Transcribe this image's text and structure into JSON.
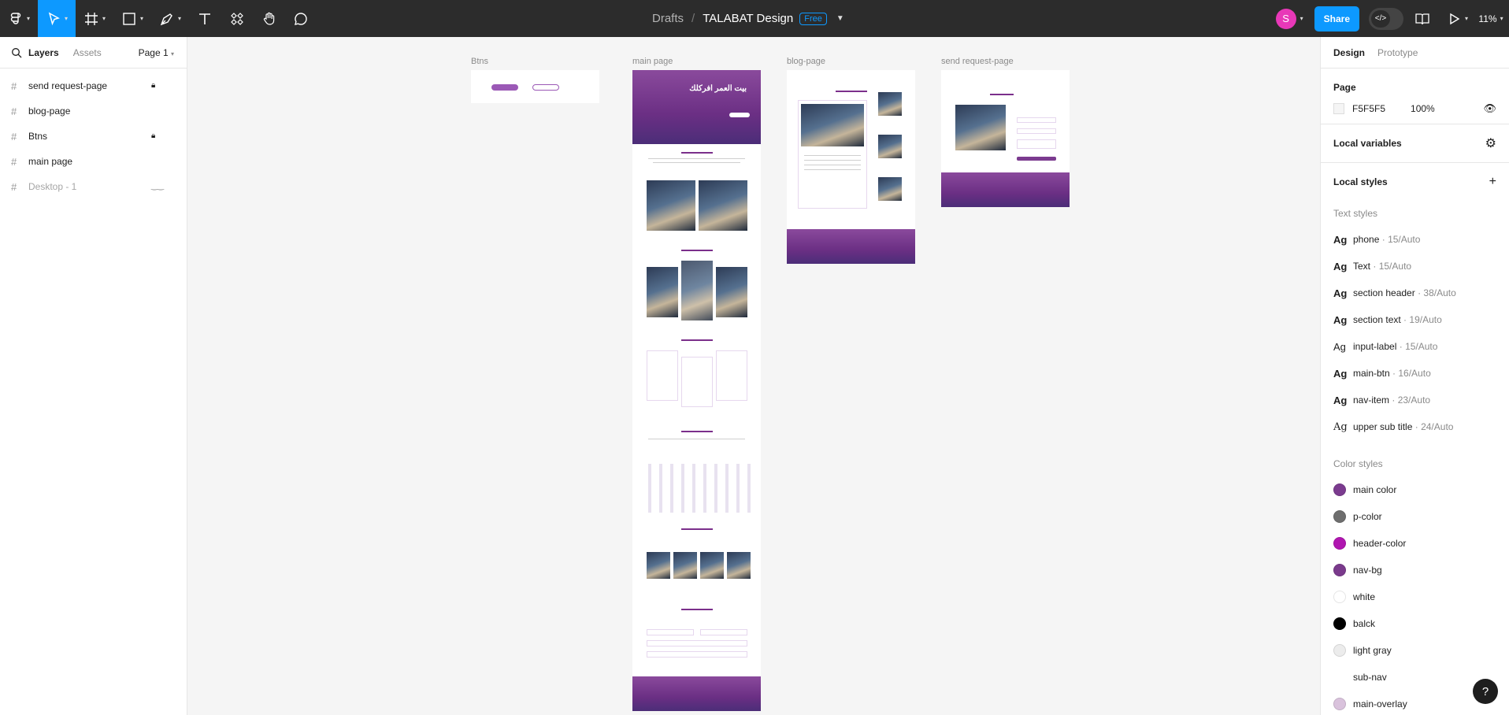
{
  "toolbar": {
    "breadcrumb": "Drafts",
    "separator": "/",
    "file_name": "TALABAT Design",
    "plan_badge": "Free",
    "avatar_initial": "S",
    "share_label": "Share",
    "zoom": "11%"
  },
  "left_panel": {
    "tabs": {
      "layers": "Layers",
      "assets": "Assets"
    },
    "page_selector": "Page 1",
    "layers": [
      {
        "name": "send request-page",
        "locked": true,
        "hidden": false
      },
      {
        "name": "blog-page",
        "locked": false,
        "hidden": false
      },
      {
        "name": "Btns",
        "locked": true,
        "hidden": false
      },
      {
        "name": "main page",
        "locked": false,
        "hidden": false
      },
      {
        "name": "Desktop - 1",
        "locked": false,
        "hidden": true
      }
    ]
  },
  "canvas": {
    "frames": {
      "btns": "Btns",
      "main": "main page",
      "blog": "blog-page",
      "send": "send request-page"
    },
    "hero_heading": "بيت العمر افركلك"
  },
  "right_panel": {
    "tabs": {
      "design": "Design",
      "prototype": "Prototype"
    },
    "page": {
      "heading": "Page",
      "color": "F5F5F5",
      "opacity": "100%"
    },
    "local_variables": "Local variables",
    "local_styles": "Local styles",
    "text_styles_heading": "Text styles",
    "text_styles": [
      {
        "name": "phone",
        "meta": "15/Auto"
      },
      {
        "name": "Text",
        "meta": "15/Auto"
      },
      {
        "name": "section header",
        "meta": "38/Auto"
      },
      {
        "name": "section text",
        "meta": "19/Auto"
      },
      {
        "name": "input-label",
        "meta": "15/Auto"
      },
      {
        "name": "main-btn",
        "meta": "16/Auto"
      },
      {
        "name": "nav-item",
        "meta": "23/Auto"
      },
      {
        "name": "upper sub title",
        "meta": "24/Auto"
      }
    ],
    "text_style_prefix": "Ag",
    "meta_separator": "·",
    "color_styles_heading": "Color styles",
    "color_styles": [
      {
        "name": "main color",
        "color": "#7b3b8f"
      },
      {
        "name": "p-color",
        "color": "#6e6e6e"
      },
      {
        "name": "header-color",
        "color": "#b016b0"
      },
      {
        "name": "nav-bg",
        "color": "#7a3a8c"
      },
      {
        "name": "white",
        "color": "#ffffff"
      },
      {
        "name": "balck",
        "color": "#000000"
      },
      {
        "name": "light gray",
        "color": "#ececec"
      },
      {
        "name": "sub-nav",
        "color": "#ffffff"
      },
      {
        "name": "main-overlay",
        "color": "#d9c2dc"
      }
    ],
    "help": "?"
  }
}
